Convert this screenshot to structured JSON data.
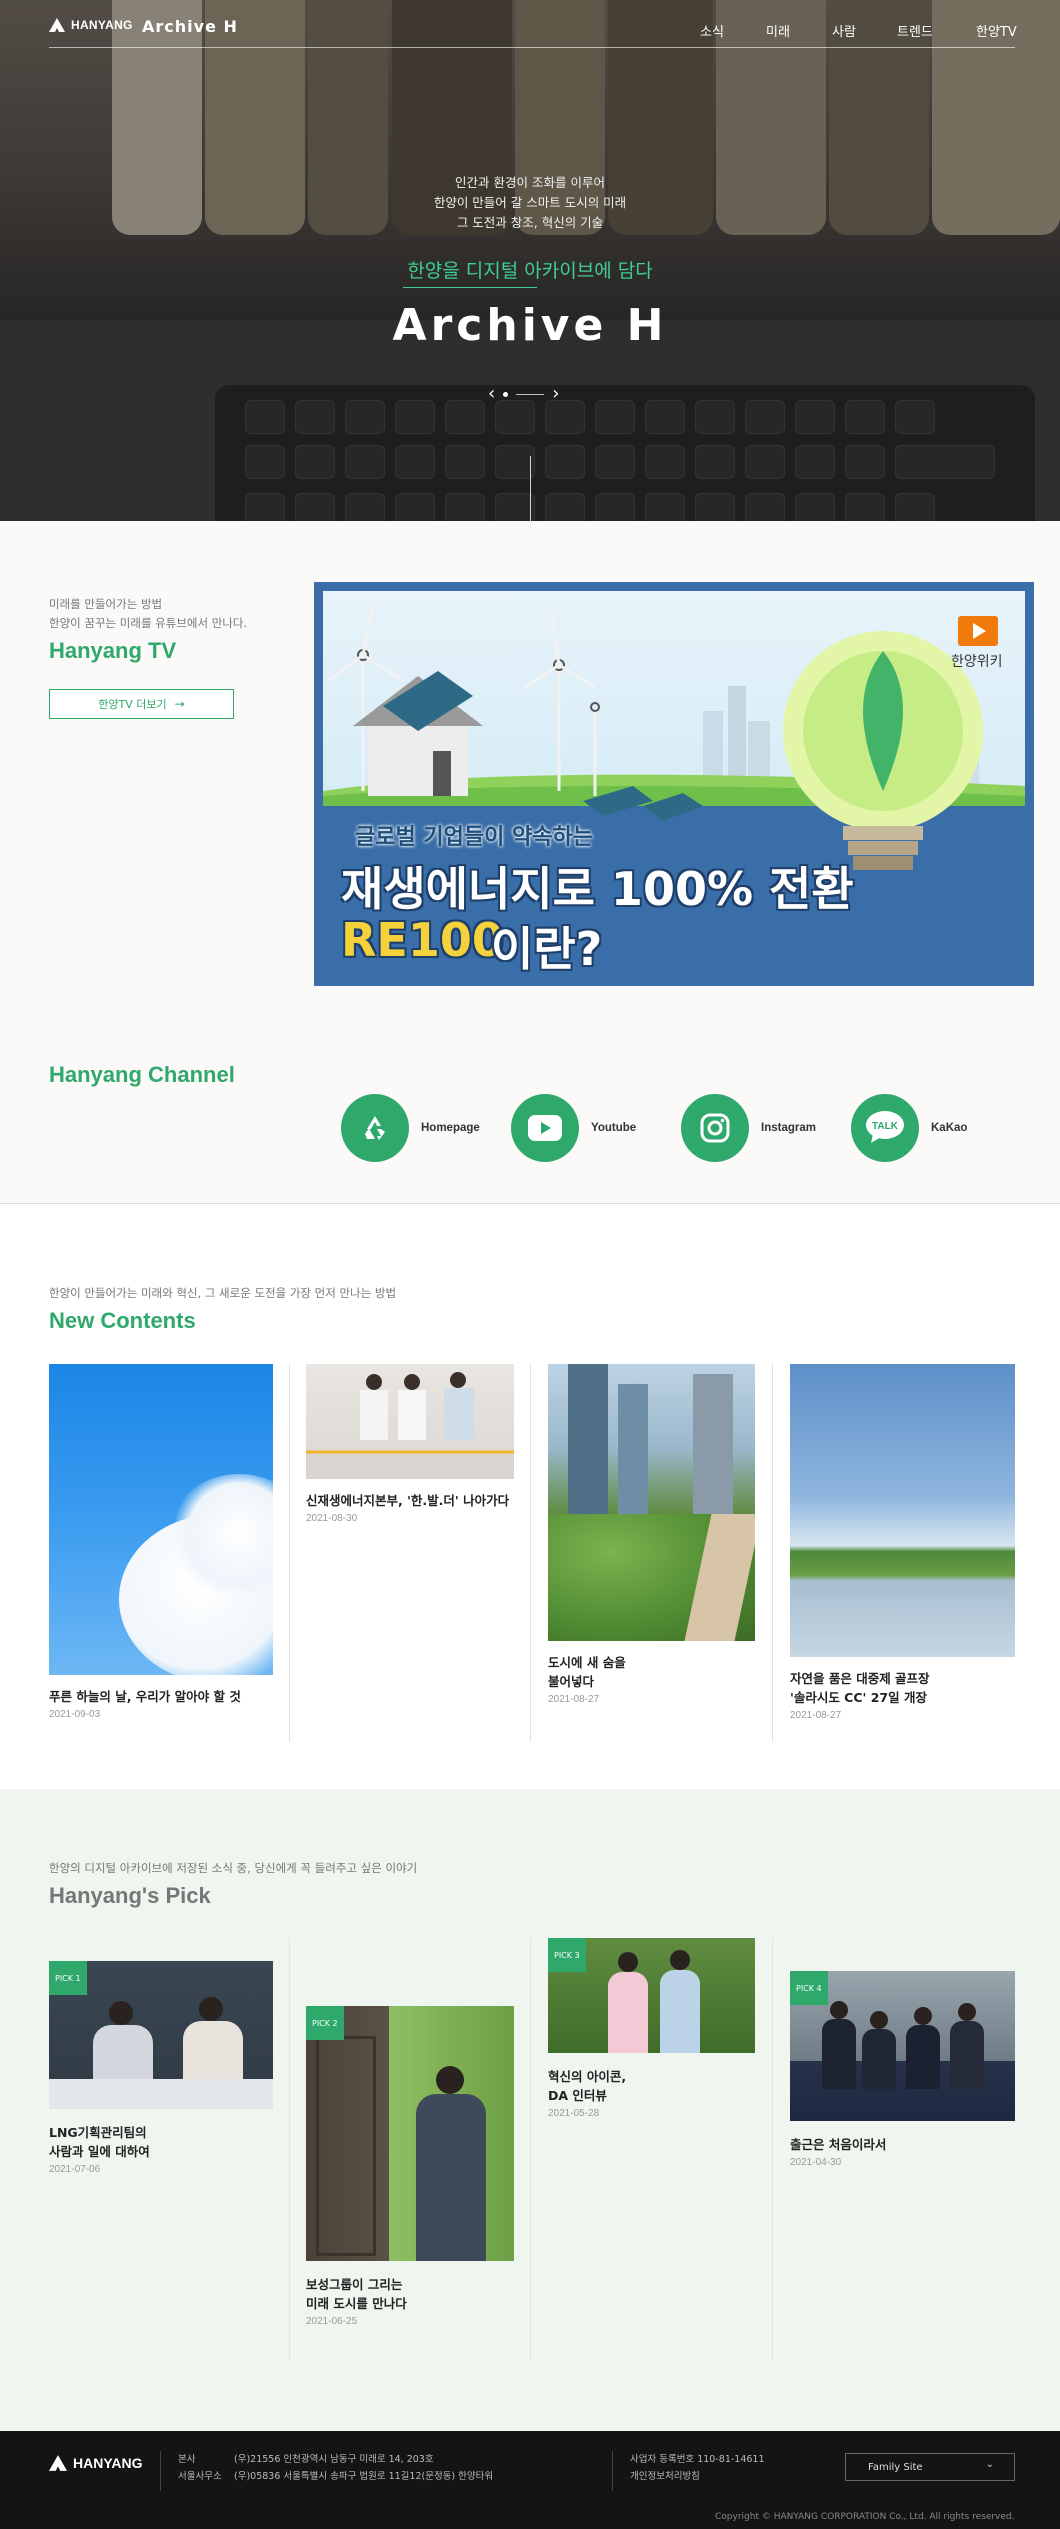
{
  "header": {
    "logo_text": "HANYANG",
    "site_name": "Archive H",
    "nav": [
      "소식",
      "미래",
      "사람",
      "트렌드",
      "한양TV"
    ]
  },
  "hero": {
    "lines": [
      "인간과 환경이 조화를 이루어",
      "한양이 만들어 갈 스마트 도시의 미래",
      "그 도전과 창조, 혁신의 기술"
    ],
    "subtitle": "한양을 디지털 아카이브에 담다",
    "title": "Archive H",
    "slider_prev": "‹",
    "slider_next": "›"
  },
  "tv": {
    "intro": [
      "미래를 만들어가는 방법",
      "한양이 꿈꾸는 미래를 유튜브에서 만나다."
    ],
    "title": "Hanyang TV",
    "more_button": "한양TV 더보기",
    "video": {
      "channel_name": "한양위키",
      "caption_small": "글로벌 기업들이 약속하는",
      "caption_big": "재생에너지로 100% 전환",
      "caption_accent": "RE100",
      "caption_tail": "이란?"
    }
  },
  "channel": {
    "title": "Hanyang Channel",
    "items": [
      {
        "label": "Homepage",
        "icon": "recycle-logo-icon"
      },
      {
        "label": "Youtube",
        "icon": "youtube-icon"
      },
      {
        "label": "Instagram",
        "icon": "instagram-icon"
      },
      {
        "label": "KaKao",
        "icon": "kakao-talk-icon"
      }
    ],
    "kakao_badge": "TALK"
  },
  "new_contents": {
    "intro": "한양이 만들어가는 미래와 혁신, 그 새로운 도전을 가장 먼저 만나는 방법",
    "title": "New Contents",
    "items": [
      {
        "title": [
          "푸른 하늘의 날, 우리가 알아야 할 것"
        ],
        "date": "2021-09-03"
      },
      {
        "title": [
          "신재생에너지본부, '한.발.더' 나아가다"
        ],
        "date": "2021-08-30"
      },
      {
        "title": [
          "도시에 새 숨을",
          "불어넣다"
        ],
        "date": "2021-08-27"
      },
      {
        "title": [
          "자연을 품은 대중제 골프장",
          "'솔라시도 CC' 27일 개장"
        ],
        "date": "2021-08-27"
      }
    ]
  },
  "pick": {
    "intro": "한양의 디지털 아카이브에 저장된 소식 중, 당신에게 꼭 들려주고 싶은 이야기",
    "title": "Hanyang's Pick",
    "items": [
      {
        "tag": "PICK 1",
        "title": [
          "LNG기획관리팀의",
          "사람과 일에 대하여"
        ],
        "date": "2021-07-06"
      },
      {
        "tag": "PICK 2",
        "title": [
          "보성그룹이 그리는",
          "미래 도시를 만나다"
        ],
        "date": "2021-06-25"
      },
      {
        "tag": "PICK 3",
        "title": [
          "혁신의 아이콘,",
          "DA 인터뷰"
        ],
        "date": "2021-05-28"
      },
      {
        "tag": "PICK 4",
        "title": [
          "출근은 처음이라서"
        ],
        "date": "2021-04-30"
      }
    ]
  },
  "footer": {
    "logo_text": "HANYANG",
    "hq_label": "본사",
    "hq_address": "(우)21556 인천광역시 남동구 미래로 14, 203호",
    "seoul_label": "서울사무소",
    "seoul_address": "(우)05836 서울특별시 송파구 법원로 11길12(문정동) 한양타워",
    "biz_number": "사업자 등록번호 110-81-14611",
    "privacy": "개인정보처리방침",
    "family_site": "Family Site",
    "copyright": "Copyright © HANYANG CORPORATION Co., Ltd. All rights reserved."
  },
  "colors": {
    "accent": "#2fa86b",
    "footer_bg": "#141414",
    "pick_bg": "#eef6ef"
  }
}
